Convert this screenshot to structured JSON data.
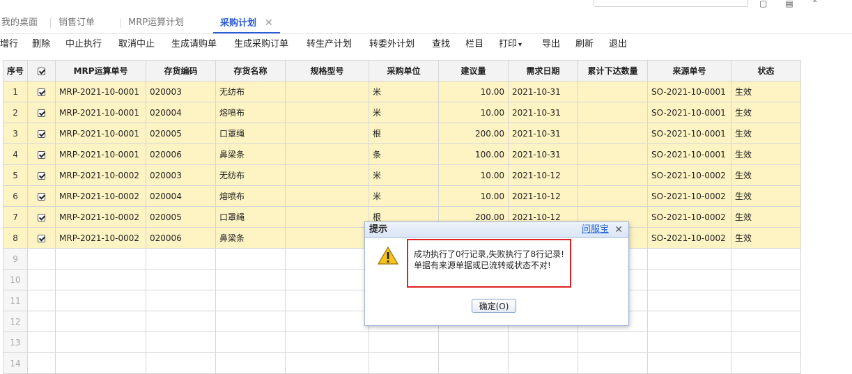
{
  "tabs": [
    {
      "label": "我的桌面"
    },
    {
      "label": "销售订单"
    },
    {
      "label": "MRP运算计划"
    },
    {
      "label": "采购计划"
    }
  ],
  "toolbar": {
    "add": "增行",
    "delete": "删除",
    "suspend": "中止执行",
    "unsuspend": "取消中止",
    "gen_requisition": "生成请购单",
    "gen_po": "生成采购订单",
    "to_production": "转生产计划",
    "to_outsource": "转委外计划",
    "find": "查找",
    "columns": "栏目",
    "print": "打印",
    "export": "导出",
    "refresh": "刷新",
    "exit": "退出"
  },
  "grid": {
    "headers": [
      "序号",
      "",
      "MRP运算单号",
      "存货编码",
      "存货名称",
      "规格型号",
      "采购单位",
      "建议量",
      "需求日期",
      "累计下达数量",
      "来源单号",
      "状态"
    ],
    "rows": [
      {
        "seq": "1",
        "mrp": "MRP-2021-10-0001",
        "code": "020003",
        "name": "无纺布",
        "spec": "",
        "unit": "米",
        "qty": "10.00",
        "date": "2021-10-31",
        "cum": "",
        "src": "SO-2021-10-0001",
        "status": "生效"
      },
      {
        "seq": "2",
        "mrp": "MRP-2021-10-0001",
        "code": "020004",
        "name": "熔喷布",
        "spec": "",
        "unit": "米",
        "qty": "10.00",
        "date": "2021-10-31",
        "cum": "",
        "src": "SO-2021-10-0001",
        "status": "生效"
      },
      {
        "seq": "3",
        "mrp": "MRP-2021-10-0001",
        "code": "020005",
        "name": "口罩绳",
        "spec": "",
        "unit": "根",
        "qty": "200.00",
        "date": "2021-10-31",
        "cum": "",
        "src": "SO-2021-10-0001",
        "status": "生效"
      },
      {
        "seq": "4",
        "mrp": "MRP-2021-10-0001",
        "code": "020006",
        "name": "鼻梁条",
        "spec": "",
        "unit": "条",
        "qty": "100.00",
        "date": "2021-10-31",
        "cum": "",
        "src": "SO-2021-10-0001",
        "status": "生效"
      },
      {
        "seq": "5",
        "mrp": "MRP-2021-10-0002",
        "code": "020003",
        "name": "无纺布",
        "spec": "",
        "unit": "米",
        "qty": "10.00",
        "date": "2021-10-12",
        "cum": "",
        "src": "SO-2021-10-0002",
        "status": "生效"
      },
      {
        "seq": "6",
        "mrp": "MRP-2021-10-0002",
        "code": "020004",
        "name": "熔喷布",
        "spec": "",
        "unit": "米",
        "qty": "10.00",
        "date": "2021-10-12",
        "cum": "",
        "src": "SO-2021-10-0002",
        "status": "生效"
      },
      {
        "seq": "7",
        "mrp": "MRP-2021-10-0002",
        "code": "020005",
        "name": "口罩绳",
        "spec": "",
        "unit": "根",
        "qty": "200.00",
        "date": "2021-10-12",
        "cum": "",
        "src": "SO-2021-10-0002",
        "status": "生效"
      },
      {
        "seq": "8",
        "mrp": "MRP-2021-10-0002",
        "code": "020006",
        "name": "鼻梁条",
        "spec": "",
        "unit": "",
        "qty": "",
        "date": "",
        "cum": "",
        "src": "SO-2021-10-0002",
        "status": "生效"
      }
    ],
    "empty_rows": [
      "9",
      "10",
      "11",
      "12",
      "13",
      "14"
    ]
  },
  "dialog": {
    "title": "提示",
    "help_link": "问服宝",
    "message_line1": "成功执行了0行记录,失败执行了8行记录!",
    "message_line2": "单据有来源单据或已流转或状态不对!",
    "ok_label": "确定(O)"
  },
  "colors": {
    "accent": "#2a5bd7",
    "row_highlight": "#fdf3c3",
    "alert_border": "#e02020"
  }
}
